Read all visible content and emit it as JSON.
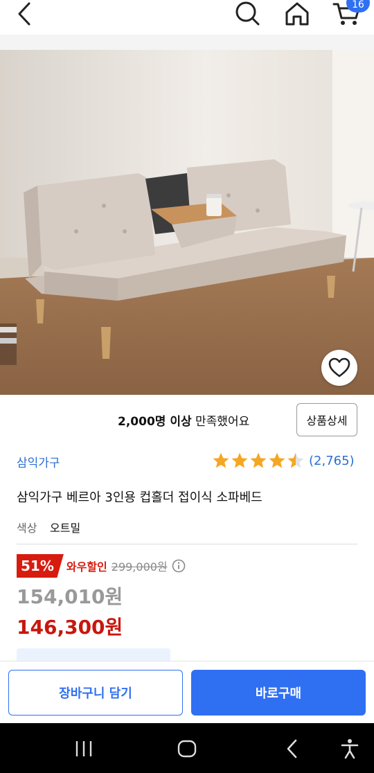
{
  "topbar": {
    "back_icon": "chevron-left-icon",
    "search_icon": "search-icon",
    "home_icon": "home-icon",
    "cart_icon": "cart-icon",
    "cart_count": "16",
    "accent": "#2f6ff2"
  },
  "gallery": {
    "slide_count": 6,
    "active_slide": 1
  },
  "satisfaction": {
    "count": "2,000명 이상",
    "suffix": " 만족했어요",
    "detail_button": "상품상세"
  },
  "product": {
    "brand": "삼익가구",
    "rating": 4.5,
    "review_count": "(2,765)",
    "title": "삼익가구 베르아 3인용 컵홀더 접이식 소파베드",
    "color_label": "색상",
    "color_value": "오트밀"
  },
  "price": {
    "discount": "51%",
    "wow_label": "와우할인",
    "original": "299,000원",
    "sale": "154,010원",
    "wow_price": "146,300원",
    "red": "#d81b0f"
  },
  "actions": {
    "add_to_cart": "장바구니 담기",
    "buy_now": "바로구매"
  },
  "system_nav": {
    "recent_icon": "recent-apps-icon",
    "home_icon": "home-circle-icon",
    "back_icon": "back-icon",
    "accessibility_icon": "accessibility-icon"
  }
}
